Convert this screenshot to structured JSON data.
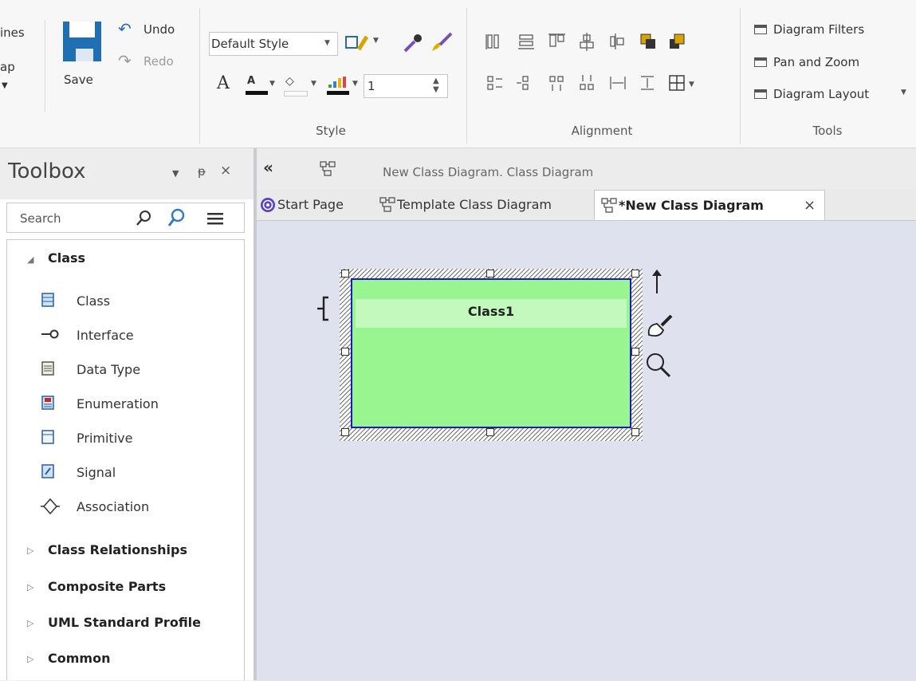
{
  "ribbon": {
    "partial_left": [
      "ines",
      "ap"
    ],
    "save_label": "Save",
    "undo_label": "Undo",
    "redo_label": "Redo",
    "style_value": "Default Style",
    "line_width_value": "1",
    "groups": {
      "style": "Style",
      "alignment": "Alignment",
      "tools": "Tools"
    },
    "tools": [
      "Diagram Filters",
      "Pan and Zoom",
      "Diagram Layout"
    ]
  },
  "toolbox": {
    "title": "Toolbox",
    "search_placeholder": "Search",
    "categories": [
      {
        "label": "Class",
        "expanded": true
      },
      {
        "label": "Class Relationships",
        "expanded": false
      },
      {
        "label": "Composite Parts",
        "expanded": false
      },
      {
        "label": "UML Standard Profile",
        "expanded": false
      },
      {
        "label": "Common",
        "expanded": false
      }
    ],
    "items": [
      {
        "label": "Class",
        "icon": "class-icon"
      },
      {
        "label": "Interface",
        "icon": "interface-icon"
      },
      {
        "label": "Data Type",
        "icon": "data-type-icon"
      },
      {
        "label": "Enumeration",
        "icon": "enumeration-icon"
      },
      {
        "label": "Primitive",
        "icon": "primitive-icon"
      },
      {
        "label": "Signal",
        "icon": "signal-icon"
      },
      {
        "label": "Association",
        "icon": "association-icon"
      }
    ]
  },
  "document": {
    "breadcrumb": "New Class Diagram.  Class Diagram",
    "tabs": [
      {
        "label": "Start Page",
        "active": false
      },
      {
        "label": "Template Class Diagram",
        "active": false
      },
      {
        "label": "*New Class Diagram",
        "active": true
      }
    ],
    "close_glyph": "×"
  },
  "diagram": {
    "element_name": "Class1",
    "colors": {
      "fill": "#98f58f",
      "border": "#1a1acc",
      "name_band": "#c3f9bd",
      "canvas": "#dfe2ee"
    }
  }
}
